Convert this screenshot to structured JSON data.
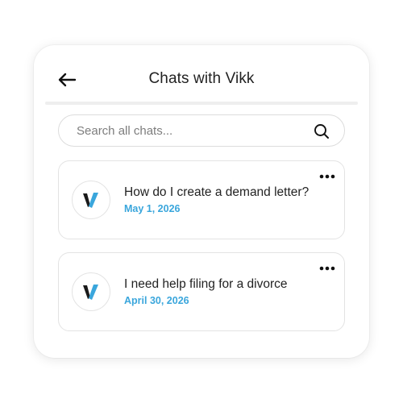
{
  "header": {
    "title": "Chats with Vikk",
    "back_icon": "arrow-left-icon"
  },
  "search": {
    "placeholder": "Search all chats...",
    "value": "",
    "icon": "search-icon"
  },
  "chats": [
    {
      "title": "How do I create a demand letter?",
      "date": "May 1, 2026",
      "avatar_icon": "vikk-logo-icon",
      "menu_icon": "more-horizontal-icon"
    },
    {
      "title": "I need help filing for a divorce",
      "date": "April 30, 2026",
      "avatar_icon": "vikk-logo-icon",
      "menu_icon": "more-horizontal-icon"
    }
  ],
  "colors": {
    "accent": "#3aa6dc",
    "text": "#222222",
    "border": "#e3e3e3"
  }
}
